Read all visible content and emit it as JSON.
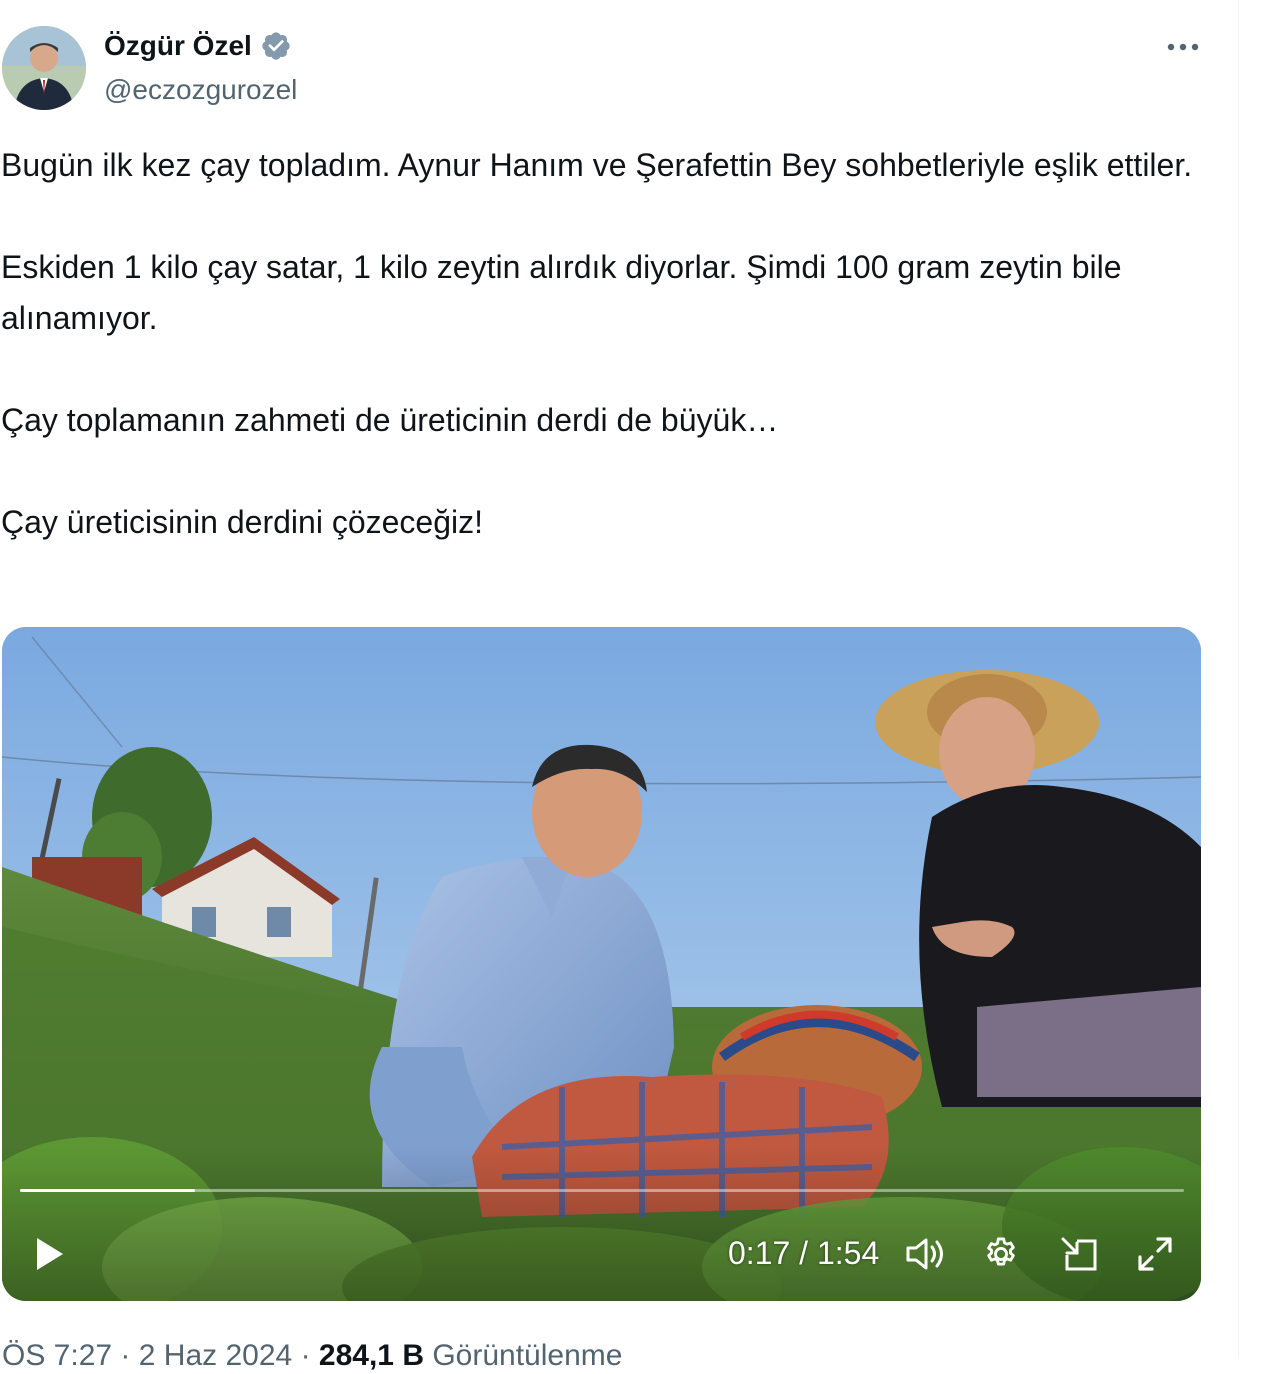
{
  "author": {
    "name": "Özgür Özel",
    "handle": "@eczozgurozel",
    "verified": true
  },
  "tweet": {
    "paragraphs": [
      "Bugün ilk kez çay topladım. Aynur Hanım ve Şerafettin Bey sohbetleriyle eşlik ettiler.",
      "Eskiden 1 kilo çay satar, 1 kilo zeytin alırdık diyorlar. Şimdi 100 gram zeytin bile alınamıyor.",
      "Çay toplamanın zahmeti de üreticinin derdi de büyük…",
      "Çay üreticisinin derdini çözeceğiz!"
    ]
  },
  "video": {
    "current_time": "0:17",
    "duration": "1:54",
    "time_display": "0:17 / 1:54",
    "progress_fraction": 0.15
  },
  "meta": {
    "time": "ÖS 7:27",
    "separator": "·",
    "date": "2 Haz 2024",
    "views_count": "284,1 B",
    "views_label": "Görüntülenme"
  },
  "icons": {
    "more": "more-horizontal-icon",
    "verified": "verified-badge-icon",
    "play": "play-icon",
    "volume": "volume-icon",
    "settings": "gear-icon",
    "pip": "picture-in-picture-icon",
    "fullscreen": "fullscreen-icon"
  },
  "colors": {
    "text_primary": "#0f1419",
    "text_secondary": "#536471",
    "verified_badge": "#829aab"
  }
}
